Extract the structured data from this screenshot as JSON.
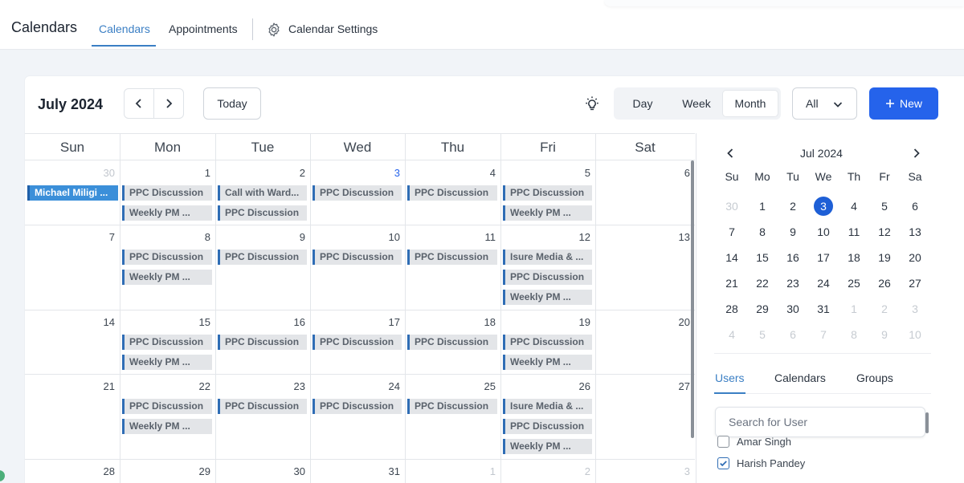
{
  "topnav": {
    "title": "Calendars",
    "tabs": [
      {
        "label": "Calendars",
        "active": true
      },
      {
        "label": "Appointments",
        "active": false
      },
      {
        "label": "Calendar Settings",
        "active": false
      }
    ]
  },
  "toolbar": {
    "month_label": "July 2024",
    "today_label": "Today",
    "views": [
      "Day",
      "Week",
      "Month"
    ],
    "active_view": "Month",
    "filter_value": "All",
    "new_label": "New"
  },
  "calendar": {
    "days_of_week": [
      "Sun",
      "Mon",
      "Tue",
      "Wed",
      "Thu",
      "Fri",
      "Sat"
    ],
    "weeks": [
      {
        "days": [
          {
            "num": "30",
            "muted": true,
            "events": [
              {
                "title": "Michael Miligi ...",
                "style": "blue"
              }
            ]
          },
          {
            "num": "1",
            "events": [
              {
                "title": "PPC Discussion"
              },
              {
                "title": "Weekly PM ..."
              }
            ]
          },
          {
            "num": "2",
            "events": [
              {
                "title": "Call with Ward..."
              },
              {
                "title": "PPC Discussion"
              }
            ]
          },
          {
            "num": "3",
            "today": true,
            "events": [
              {
                "title": "PPC Discussion"
              }
            ]
          },
          {
            "num": "4",
            "events": [
              {
                "title": "PPC Discussion"
              }
            ]
          },
          {
            "num": "5",
            "events": [
              {
                "title": "PPC Discussion"
              },
              {
                "title": "Weekly PM ..."
              }
            ]
          },
          {
            "num": "6",
            "events": []
          }
        ]
      },
      {
        "days": [
          {
            "num": "7",
            "events": []
          },
          {
            "num": "8",
            "events": [
              {
                "title": "PPC Discussion"
              },
              {
                "title": "Weekly PM ..."
              }
            ]
          },
          {
            "num": "9",
            "events": [
              {
                "title": "PPC Discussion"
              }
            ]
          },
          {
            "num": "10",
            "events": [
              {
                "title": "PPC Discussion"
              }
            ]
          },
          {
            "num": "11",
            "events": [
              {
                "title": "PPC Discussion"
              }
            ]
          },
          {
            "num": "12",
            "events": [
              {
                "title": "Isure Media & ..."
              },
              {
                "title": "PPC Discussion"
              },
              {
                "title": "Weekly PM ..."
              }
            ]
          },
          {
            "num": "13",
            "events": []
          }
        ]
      },
      {
        "days": [
          {
            "num": "14",
            "events": []
          },
          {
            "num": "15",
            "events": [
              {
                "title": "PPC Discussion"
              },
              {
                "title": "Weekly PM ..."
              }
            ]
          },
          {
            "num": "16",
            "events": [
              {
                "title": "PPC Discussion"
              }
            ]
          },
          {
            "num": "17",
            "events": [
              {
                "title": "PPC Discussion"
              }
            ]
          },
          {
            "num": "18",
            "events": [
              {
                "title": "PPC Discussion"
              }
            ]
          },
          {
            "num": "19",
            "events": [
              {
                "title": "PPC Discussion"
              },
              {
                "title": "Weekly PM ..."
              }
            ]
          },
          {
            "num": "20",
            "events": []
          }
        ]
      },
      {
        "days": [
          {
            "num": "21",
            "events": []
          },
          {
            "num": "22",
            "events": [
              {
                "title": "PPC Discussion"
              },
              {
                "title": "Weekly PM ..."
              }
            ]
          },
          {
            "num": "23",
            "events": [
              {
                "title": "PPC Discussion"
              }
            ]
          },
          {
            "num": "24",
            "events": [
              {
                "title": "PPC Discussion"
              }
            ]
          },
          {
            "num": "25",
            "events": [
              {
                "title": "PPC Discussion"
              }
            ]
          },
          {
            "num": "26",
            "events": [
              {
                "title": "Isure Media & ..."
              },
              {
                "title": "PPC Discussion"
              },
              {
                "title": "Weekly PM ..."
              }
            ]
          },
          {
            "num": "27",
            "events": []
          }
        ]
      },
      {
        "days": [
          {
            "num": "28",
            "events": []
          },
          {
            "num": "29",
            "events": []
          },
          {
            "num": "30",
            "events": []
          },
          {
            "num": "31",
            "events": []
          },
          {
            "num": "1",
            "muted": true,
            "events": []
          },
          {
            "num": "2",
            "muted": true,
            "events": []
          },
          {
            "num": "3",
            "muted": true,
            "events": []
          }
        ]
      }
    ]
  },
  "mini_calendar": {
    "title": "Jul 2024",
    "days_of_week": [
      "Su",
      "Mo",
      "Tu",
      "We",
      "Th",
      "Fr",
      "Sa"
    ],
    "weeks": [
      [
        {
          "n": "30",
          "muted": true
        },
        {
          "n": "1"
        },
        {
          "n": "2"
        },
        {
          "n": "3",
          "selected": true
        },
        {
          "n": "4"
        },
        {
          "n": "5"
        },
        {
          "n": "6"
        }
      ],
      [
        {
          "n": "7"
        },
        {
          "n": "8"
        },
        {
          "n": "9"
        },
        {
          "n": "10"
        },
        {
          "n": "11"
        },
        {
          "n": "12"
        },
        {
          "n": "13"
        }
      ],
      [
        {
          "n": "14"
        },
        {
          "n": "15"
        },
        {
          "n": "16"
        },
        {
          "n": "17"
        },
        {
          "n": "18"
        },
        {
          "n": "19"
        },
        {
          "n": "20"
        }
      ],
      [
        {
          "n": "21"
        },
        {
          "n": "22"
        },
        {
          "n": "23"
        },
        {
          "n": "24"
        },
        {
          "n": "25"
        },
        {
          "n": "26"
        },
        {
          "n": "27"
        }
      ],
      [
        {
          "n": "28"
        },
        {
          "n": "29"
        },
        {
          "n": "30"
        },
        {
          "n": "31"
        },
        {
          "n": "1",
          "muted": true
        },
        {
          "n": "2",
          "muted": true
        },
        {
          "n": "3",
          "muted": true
        }
      ],
      [
        {
          "n": "4",
          "muted": true
        },
        {
          "n": "5",
          "muted": true
        },
        {
          "n": "6",
          "muted": true
        },
        {
          "n": "7",
          "muted": true
        },
        {
          "n": "8",
          "muted": true
        },
        {
          "n": "9",
          "muted": true
        },
        {
          "n": "10",
          "muted": true
        }
      ]
    ]
  },
  "sidebar": {
    "tabs": [
      {
        "label": "Users",
        "active": true
      },
      {
        "label": "Calendars",
        "active": false
      },
      {
        "label": "Groups",
        "active": false
      }
    ],
    "search_placeholder": "Search for User",
    "users": [
      {
        "name": "Amar Singh",
        "checked": false
      },
      {
        "name": "Harish Pandey",
        "checked": true
      }
    ]
  },
  "colors": {
    "accent": "#3b7fc4",
    "primary_button": "#2563eb",
    "event_bg": "#e3e5e8",
    "event_bar": "#2f6db5",
    "event_blue": "#3b8fd9"
  }
}
